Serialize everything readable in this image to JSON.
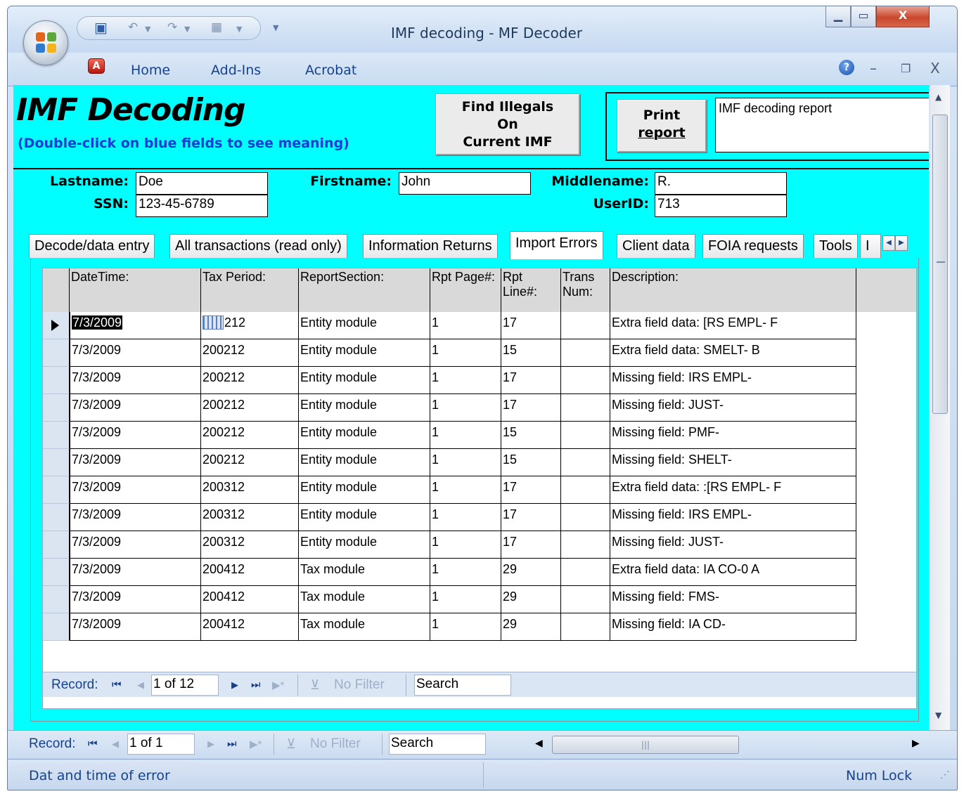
{
  "window": {
    "title": "IMF decoding - MF Decoder",
    "min_label": "▁",
    "max_label": "▭",
    "close_label": "X"
  },
  "ribbon": {
    "tabs": [
      "Home",
      "Add-Ins",
      "Acrobat"
    ],
    "mdi_min": "–",
    "mdi_restore": "❐",
    "mdi_close": "X"
  },
  "form": {
    "title": "IMF Decoding",
    "subtitle": "(Double-click on blue fields to see meaning)",
    "find_button": [
      "Find Illegals",
      "On",
      "Current IMF"
    ],
    "print_button": [
      "Print",
      "report"
    ],
    "report_name": "IMF decoding report",
    "fields": {
      "lastname_label": "Lastname:",
      "lastname": "Doe",
      "ssn_label": "SSN:",
      "ssn": "123-45-6789",
      "firstname_label": "Firstname:",
      "firstname": "John",
      "middlename_label": "Middlename:",
      "middlename": "R.",
      "userid_label": "UserID:",
      "userid": "713"
    }
  },
  "tabs": [
    "Decode/data entry",
    "All transactions (read only)",
    "Information Returns",
    "Import Errors",
    "Client data",
    "FOIA requests",
    "Tools",
    "I"
  ],
  "active_tab": "Import Errors",
  "grid": {
    "headers": [
      "DateTime:",
      "Tax Period:",
      "ReportSection:",
      "Rpt Page#:",
      "Rpt Line#:",
      "Trans Num:",
      "Description:"
    ],
    "rows": [
      [
        "7/3/2009",
        "200212",
        "Entity module",
        "1",
        "17",
        "",
        "Extra field data: [RS EMPL- F"
      ],
      [
        "7/3/2009",
        "200212",
        "Entity module",
        "1",
        "15",
        "",
        "Extra field data: SMELT- B"
      ],
      [
        "7/3/2009",
        "200212",
        "Entity module",
        "1",
        "17",
        "",
        "Missing field: IRS EMPL-"
      ],
      [
        "7/3/2009",
        "200212",
        "Entity module",
        "1",
        "17",
        "",
        "Missing field: JUST-"
      ],
      [
        "7/3/2009",
        "200212",
        "Entity module",
        "1",
        "15",
        "",
        "Missing field: PMF-"
      ],
      [
        "7/3/2009",
        "200212",
        "Entity module",
        "1",
        "15",
        "",
        "Missing field: SHELT-"
      ],
      [
        "7/3/2009",
        "200312",
        "Entity module",
        "1",
        "17",
        "",
        "Extra field data: :[RS EMPL- F"
      ],
      [
        "7/3/2009",
        "200312",
        "Entity module",
        "1",
        "17",
        "",
        "Missing field: IRS EMPL-"
      ],
      [
        "7/3/2009",
        "200312",
        "Entity module",
        "1",
        "17",
        "",
        "Missing field: JUST-"
      ],
      [
        "7/3/2009",
        "200412",
        "Tax module",
        "1",
        "29",
        "",
        "Extra field data: IA CO-0 A"
      ],
      [
        "7/3/2009",
        "200412",
        "Tax module",
        "1",
        "29",
        "",
        "Missing field: FMS-"
      ],
      [
        "7/3/2009",
        "200412",
        "Tax module",
        "1",
        "29",
        "",
        "Missing field: IA CD-"
      ]
    ],
    "first_row_tax_visible": "212"
  },
  "inner_nav": {
    "record_label": "Record:",
    "position": "1 of 12",
    "filter": "No Filter",
    "search": "Search"
  },
  "outer_nav": {
    "record_label": "Record:",
    "position": "1 of 1",
    "filter": "No Filter",
    "search": "Search"
  },
  "status": {
    "left": "Dat and time of error",
    "right": "Num Lock"
  },
  "colors": {
    "form_background": "#00ffff",
    "subtitle": "#1a3bd6",
    "ribbon_text": "#15428b"
  }
}
